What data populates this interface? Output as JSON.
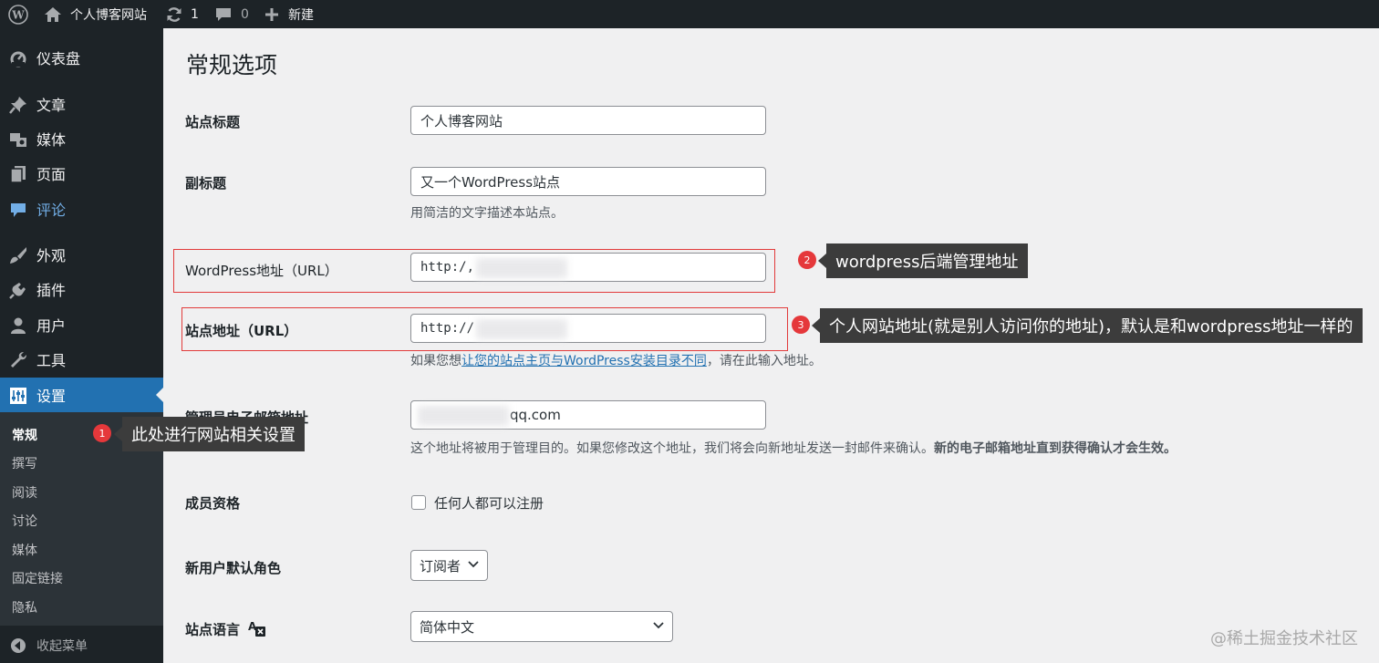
{
  "admin_bar": {
    "site_name": "个人博客网站",
    "updates_count": "1",
    "comments_count": "0",
    "new_label": "新建"
  },
  "sidebar": {
    "items": [
      {
        "label": "仪表盘",
        "icon": "dashboard-icon"
      },
      {
        "label": "文章",
        "icon": "pin-icon"
      },
      {
        "label": "媒体",
        "icon": "media-icon"
      },
      {
        "label": "页面",
        "icon": "page-icon"
      },
      {
        "label": "评论",
        "icon": "comment-icon"
      },
      {
        "label": "外观",
        "icon": "brush-icon"
      },
      {
        "label": "插件",
        "icon": "plugin-icon"
      },
      {
        "label": "用户",
        "icon": "user-icon"
      },
      {
        "label": "工具",
        "icon": "wrench-icon"
      },
      {
        "label": "设置",
        "icon": "settings-icon"
      }
    ],
    "submenu": [
      "常规",
      "撰写",
      "阅读",
      "讨论",
      "媒体",
      "固定链接",
      "隐私"
    ],
    "collapse_label": "收起菜单"
  },
  "page": {
    "title": "常规选项",
    "fields": {
      "site_title": {
        "label": "站点标题",
        "value": "个人博客网站"
      },
      "tagline": {
        "label": "副标题",
        "value": "又一个WordPress站点",
        "description": "用简洁的文字描述本站点。"
      },
      "wp_address": {
        "label": "WordPress地址（URL）",
        "value": "http:/,"
      },
      "site_address": {
        "label": "站点地址（URL）",
        "value": "http://",
        "description_pre": "如果您想",
        "description_link": "让您的站点主页与WordPress安装目录不同",
        "description_post": "，请在此输入地址。"
      },
      "admin_email": {
        "label": "管理员电子邮箱地址",
        "value": "qq.com",
        "description_pre": "这个地址将被用于管理目的。如果您修改这个地址，我们将会向新地址发送一封邮件来确认。",
        "description_bold": "新的电子邮箱地址直到获得确认才会生效。"
      },
      "membership": {
        "label": "成员资格",
        "checkbox_label": "任何人都可以注册",
        "checked": false
      },
      "default_role": {
        "label": "新用户默认角色",
        "value": "订阅者"
      },
      "site_language": {
        "label": "站点语言",
        "value": "简体中文",
        "icon": "translation-icon"
      }
    }
  },
  "annotations": [
    {
      "number": "1",
      "text": "此处进行网站相关设置"
    },
    {
      "number": "2",
      "text": "wordpress后端管理地址"
    },
    {
      "number": "3",
      "text": "个人网站地址(就是别人访问你的地址)，默认是和wordpress地址一样的"
    }
  ],
  "watermark": "@稀土掘金技术社区",
  "colors": {
    "sidebar_bg": "#1d2327",
    "accent": "#2271b1",
    "annotation_red": "#e5383b",
    "tooltip_bg": "#3c3c3c"
  }
}
